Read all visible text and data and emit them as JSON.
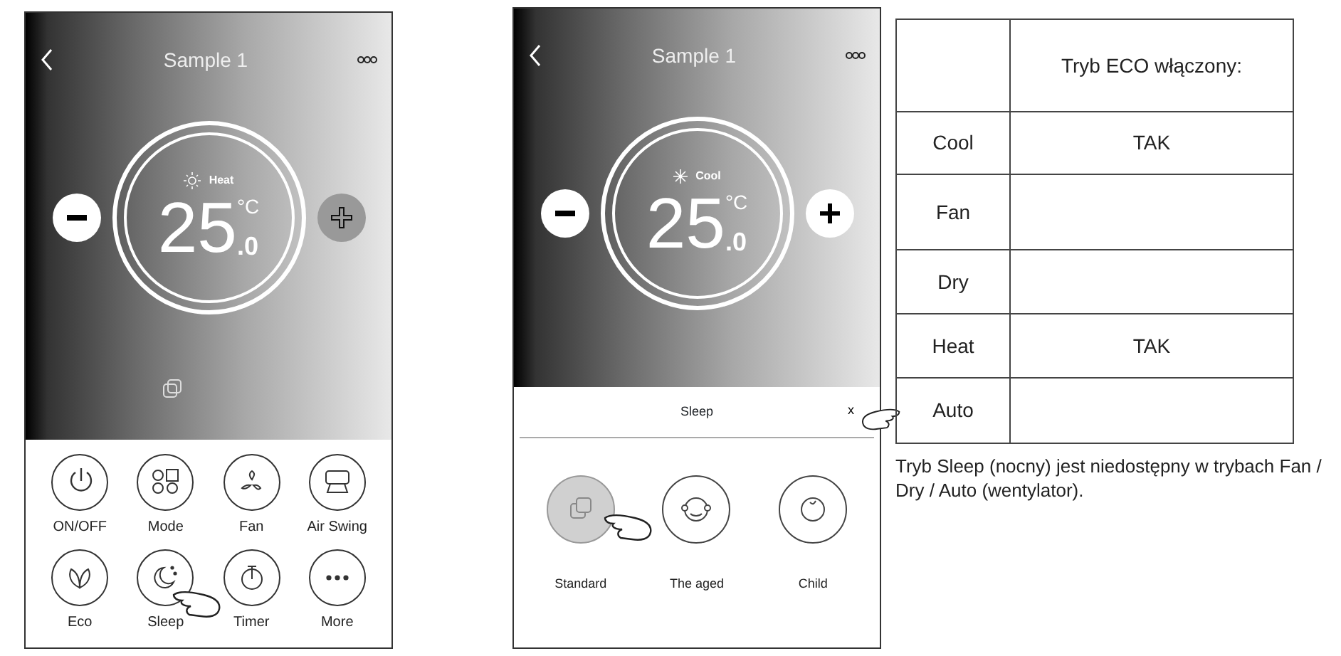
{
  "phone_main": {
    "title": "Sample 1",
    "mode": {
      "label": "Heat",
      "kind": "heat"
    },
    "temperature": "25",
    "unit": "°C",
    "decimal": ".0",
    "minus_pressed": false,
    "plus_pressed": true,
    "buttons": [
      {
        "label": "ON/OFF",
        "kind": "power",
        "tapped": false
      },
      {
        "label": "Mode",
        "kind": "mode",
        "tapped": false
      },
      {
        "label": "Fan",
        "kind": "fan",
        "tapped": false
      },
      {
        "label": "Air Swing",
        "kind": "swing",
        "tapped": false
      },
      {
        "label": "Eco",
        "kind": "eco",
        "tapped": false
      },
      {
        "label": "Sleep",
        "kind": "sleep",
        "tapped": true
      },
      {
        "label": "Timer",
        "kind": "timer",
        "tapped": false
      },
      {
        "label": "More",
        "kind": "more",
        "tapped": false
      }
    ]
  },
  "phone_sleep": {
    "title": "Sample 1",
    "mode": {
      "label": "Cool",
      "kind": "cool"
    },
    "temperature": "25",
    "unit": "°C",
    "decimal": ".0",
    "minus_pressed": false,
    "plus_pressed": false,
    "sheet": {
      "title": "Sleep",
      "close": "x"
    },
    "options": [
      {
        "label": "Standard",
        "kind": "standard",
        "selected": true
      },
      {
        "label": "The aged",
        "kind": "aged",
        "selected": false
      },
      {
        "label": "Child",
        "kind": "child",
        "selected": false
      }
    ]
  },
  "table": {
    "columns": [
      "",
      "Tryb ECO włączony:"
    ],
    "rows": [
      {
        "mode": "Cool",
        "eco": "TAK"
      },
      {
        "mode": "Fan",
        "eco": ""
      },
      {
        "mode": "Dry",
        "eco": ""
      },
      {
        "mode": "Heat",
        "eco": "TAK"
      },
      {
        "mode": "Auto",
        "eco": ""
      }
    ]
  },
  "note": "Tryb Sleep (nocny) jest niedostępny w trybach Fan / Dry / Auto (wentylator)."
}
